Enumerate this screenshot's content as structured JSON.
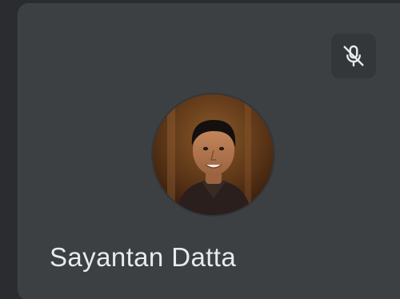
{
  "participant": {
    "name": "Sayantan Datta",
    "mic_status_icon": "mic-off-icon",
    "avatar_icon": "participant-photo"
  },
  "colors": {
    "tile_background": "#3c4043",
    "outer_background": "#2b2c2f",
    "name_text": "#e8eaed",
    "badge_background": "#34373a"
  }
}
